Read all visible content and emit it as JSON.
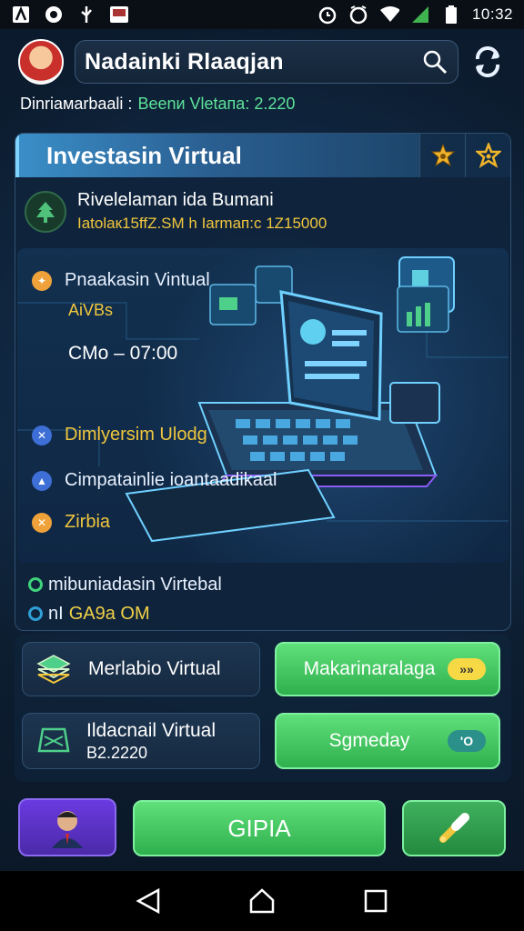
{
  "status": {
    "time": "10:32",
    "icons": [
      "app-a-icon",
      "chat-icon",
      "usb-icon",
      "photo-icon",
      "alarm-icon",
      "alarm-clock-icon",
      "wifi-icon",
      "signal-icon",
      "battery-icon"
    ]
  },
  "header": {
    "search_text": "Nadainki Rlaaqjan",
    "avatar": "profile-avatar"
  },
  "subtitle": {
    "label": "Dinriaмarbaali :",
    "value": "Beenи Vletaпa: 2.220"
  },
  "card": {
    "title": "Investasin Virtual",
    "profile_name": "Rivelelaman ida Bumani",
    "profile_meta": "Iatolaк15ffZ.SM h Iarmaп:с 1Z15000",
    "items": [
      {
        "label": "Pnaakasin Vintual",
        "icon": "orange-dot"
      },
      {
        "label": "Dimlyersim Ulodg",
        "icon": "blue-dot"
      },
      {
        "label": "Cimpatainlie ioantaadikaal",
        "icon": "blue-dot"
      },
      {
        "label": "Zirbia",
        "icon": "orange-dot"
      }
    ],
    "item1_sub": "AiVBs",
    "price": "CMo – 07:00",
    "footer": {
      "line1": "mibuniadasin Virtebal",
      "line2_prefix": "nI",
      "line2_value": "GA9a OM"
    }
  },
  "actions": {
    "left1": "Merlabio Virtual",
    "left2_title": "Ildacnail Virtual",
    "left2_sub": "B2.2220",
    "right1": "Makarinaralaga",
    "right1_pill": "»»",
    "right2": "Sgmeday",
    "right2_pill": "'O"
  },
  "bottom": {
    "center_button": "GIPIA"
  },
  "colors": {
    "accent_green": "#3fd37b",
    "accent_yellow": "#f0c63d",
    "panel_bg": "#0f243c",
    "header_blue": "#3a8fc9"
  }
}
